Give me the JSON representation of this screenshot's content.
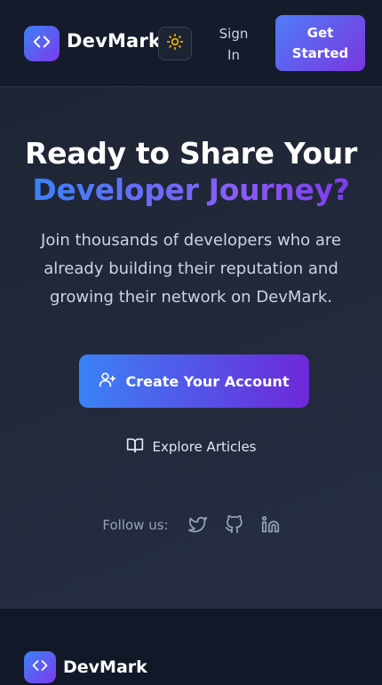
{
  "header": {
    "logo_icon": "code-brackets-icon",
    "logo_text": "DevMark",
    "theme_icon": "sun-icon",
    "signin_label": "Sign In",
    "get_started_label": "Get Started"
  },
  "hero": {
    "headline": "Ready to Share Your",
    "headline_accent": "Developer Journey?",
    "subtext": "Join thousands of developers who are already building their reputation and growing their network on DevMark.",
    "cta": {
      "icon": "user-plus-icon",
      "label": "Create Your Account"
    },
    "explore": {
      "icon": "book-open-icon",
      "label": "Explore Articles"
    },
    "follow": {
      "label": "Follow us:",
      "icons": [
        "twitter-icon",
        "github-icon",
        "linkedin-icon"
      ]
    }
  },
  "footer": {
    "logo_icon": "code-brackets-icon",
    "logo_text": "DevMark"
  },
  "colors": {
    "accent_blue": "#3b82f6",
    "accent_purple": "#7c3aed",
    "sun": "#f5b301",
    "background": "#1b2232"
  }
}
